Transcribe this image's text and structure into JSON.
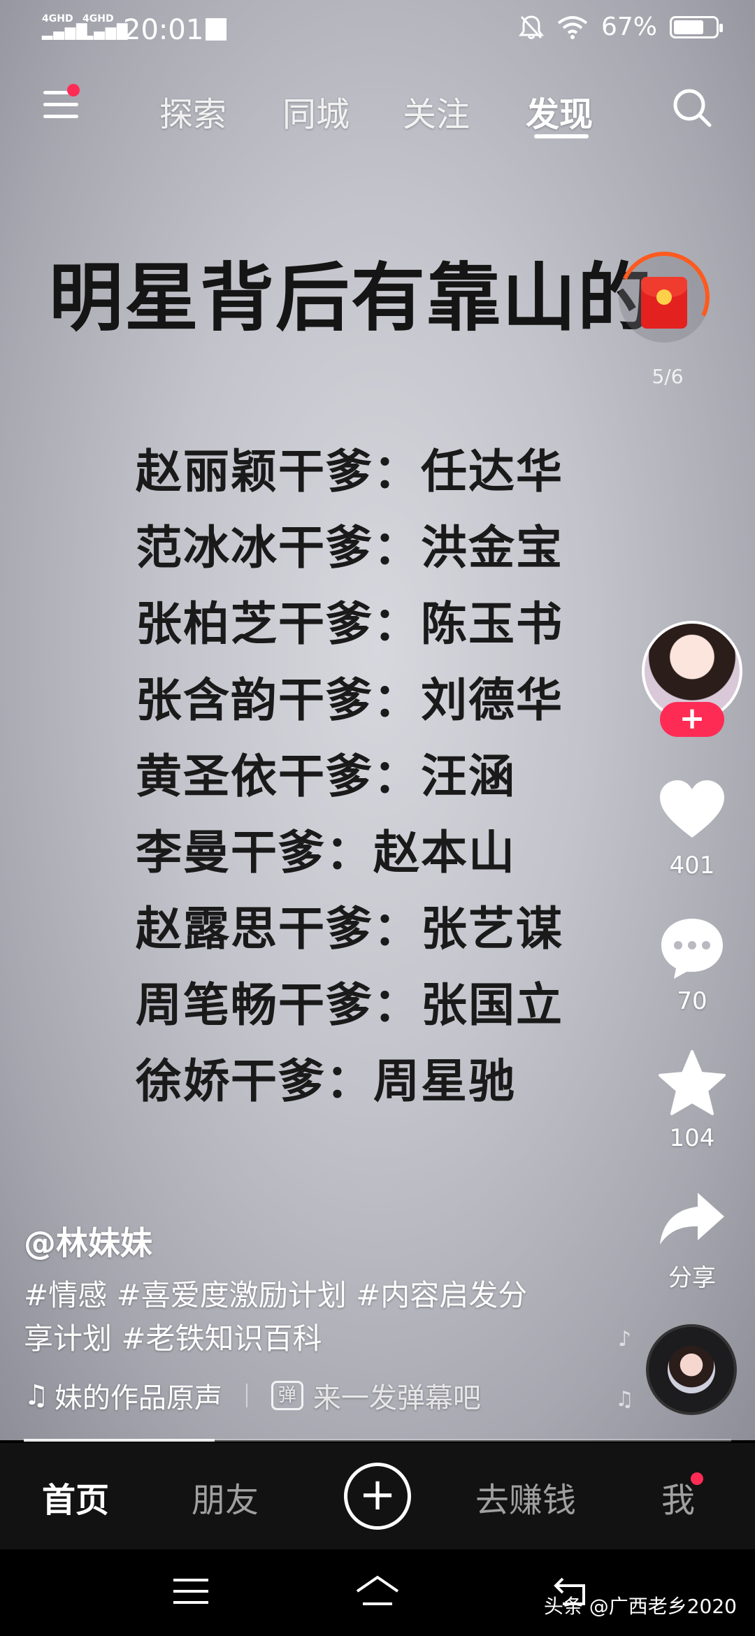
{
  "status_bar": {
    "signal_1": "4GHD",
    "signal_2": "4GHD",
    "time": "20:01",
    "battery": "67%",
    "icons": [
      "signal-icon",
      "mute-bell-icon",
      "wifi-icon",
      "battery-icon"
    ]
  },
  "top_nav": {
    "tabs": [
      {
        "label": "探索"
      },
      {
        "label": "同城"
      },
      {
        "label": "关注"
      },
      {
        "label": "发现",
        "active": true
      }
    ]
  },
  "content": {
    "title": "明星背后有靠山的",
    "progress": "5/6",
    "pairs": [
      "赵丽颖干爹：任达华",
      "范冰冰干爹：洪金宝",
      "张柏芝干爹：陈玉书",
      "张含韵干爹：刘德华",
      "黄圣依干爹：汪涵",
      "李曼干爹：赵本山",
      "赵露思干爹：张艺谋",
      "周笔畅干爹：张国立",
      "徐娇干爹：周星驰"
    ]
  },
  "rail": {
    "follow": "+",
    "likes": "401",
    "comments": "70",
    "favorites": "104",
    "share": "分享"
  },
  "caption": {
    "author": "@林妹妹",
    "description": "#情感 #喜爱度激励计划 #内容启发分享计划 #老铁知识百科",
    "music": "妹的作品原声",
    "danmu_icon": "弹",
    "danmu": "来一发弹幕吧"
  },
  "playback": {
    "progress_fraction": 0.27
  },
  "bottom_tabs": {
    "home": "首页",
    "friends": "朋友",
    "plus": "+",
    "earn": "去赚钱",
    "me": "我"
  },
  "system_nav": {
    "watermark": "头条 @广西老乡2020"
  },
  "colors": {
    "accent": "#fe2c55",
    "tabbar": "#121212",
    "title_text": "#151515"
  }
}
